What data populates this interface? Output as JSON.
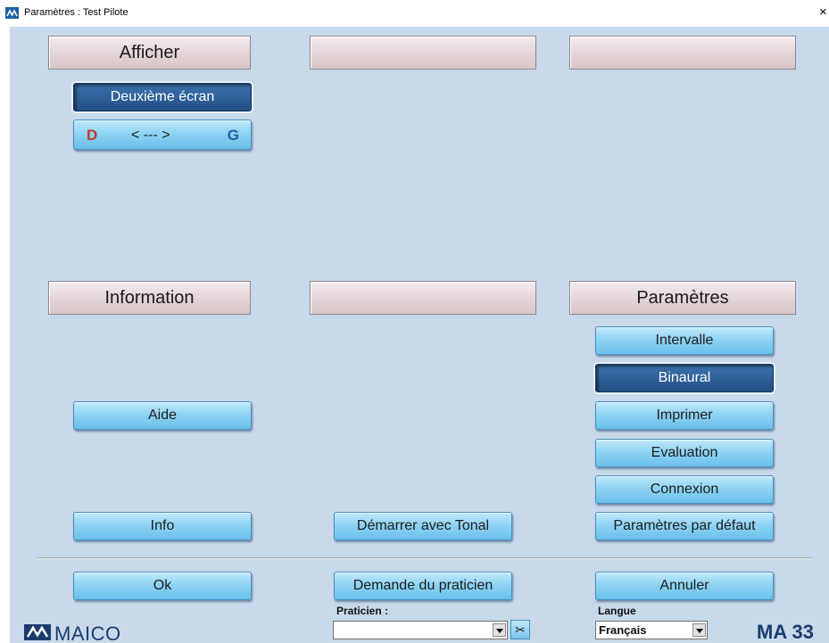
{
  "window": {
    "title": "Paramètres : Test Pilote",
    "close_glyph": "×",
    "app_icon": "maico-logo-icon"
  },
  "columns": {
    "afficher": "Afficher",
    "empty_top_middle": "",
    "empty_top_right": "",
    "information": "Information",
    "empty_bottom_middle": "",
    "parametres": "Paramètres"
  },
  "afficher": {
    "deuxieme_ecran": "Deuxième écran",
    "swap": {
      "left": "D",
      "arrow": "< --- >",
      "right": "G"
    }
  },
  "information": {
    "aide": "Aide",
    "info": "Info"
  },
  "parametres": {
    "intervalle": "Intervalle",
    "binaural": "Binaural",
    "imprimer": "Imprimer",
    "evaluation": "Evaluation",
    "connexion": "Connexion",
    "defaults": "Paramètres par défaut"
  },
  "middle": {
    "demarrer_tonal": "Démarrer avec Tonal"
  },
  "footer": {
    "ok": "Ok",
    "demande_praticien": "Demande du praticien",
    "annuler": "Annuler",
    "praticien_label": "Praticien :",
    "praticien_value": "",
    "langue_label": "Langue",
    "langue_value": "Français",
    "scissors_icon": "scissors-icon",
    "brand": "MAICO",
    "model": "MA 33"
  },
  "colors": {
    "background": "#c7d9ea",
    "button": "#8fd3f3",
    "button_active": "#2e5f98",
    "header": "#e3d3d6",
    "brand": "#1a3c6e"
  }
}
